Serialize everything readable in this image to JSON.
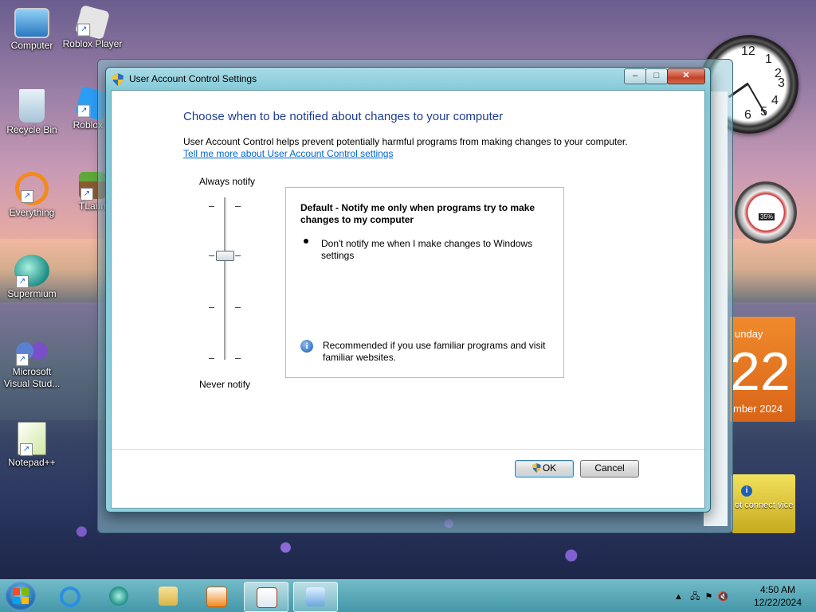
{
  "desktop": {
    "icons": [
      {
        "label": "Computer"
      },
      {
        "label": "Roblox Player"
      },
      {
        "label": "Recycle Bin"
      },
      {
        "label": "Roblox S"
      },
      {
        "label": "Everything"
      },
      {
        "label": "TLaun"
      },
      {
        "label": "Supermium"
      },
      {
        "label": "Microsoft Visual Stud..."
      },
      {
        "label": "Notepad++"
      }
    ]
  },
  "gadgets": {
    "clock_numbers": [
      "12",
      "1",
      "2",
      "3",
      "4",
      "5",
      "6"
    ],
    "cpu_meter": "35%",
    "calendar": {
      "day": "unday",
      "date": "22",
      "month": "mber 2024"
    },
    "weather": {
      "message": "ot connect vice"
    }
  },
  "dialog": {
    "title": "User Account Control Settings",
    "controls": {
      "minimize": "‒",
      "maximize": "□",
      "close": "✕"
    },
    "heading": "Choose when to be notified about changes to your computer",
    "description": "User Account Control helps prevent potentially harmful programs from making changes to your computer.",
    "link": "Tell me more about User Account Control settings",
    "slider": {
      "top_label": "Always notify",
      "bottom_label": "Never notify",
      "levels": 4,
      "selected_level": 3
    },
    "info": {
      "title": "Default - Notify me only when programs try to make changes to my computer",
      "bullet": "Don't notify me when I make changes to Windows settings",
      "recommendation": "Recommended if you use familiar programs and visit familiar websites."
    },
    "buttons": {
      "ok": "OK",
      "cancel": "Cancel"
    }
  },
  "taskbar": {
    "time": "4:50 AM",
    "date": "12/22/2024"
  },
  "colors": {
    "heading": "#1e3d8f",
    "link": "#0066cc",
    "taskbar": "#5fb3c0"
  }
}
